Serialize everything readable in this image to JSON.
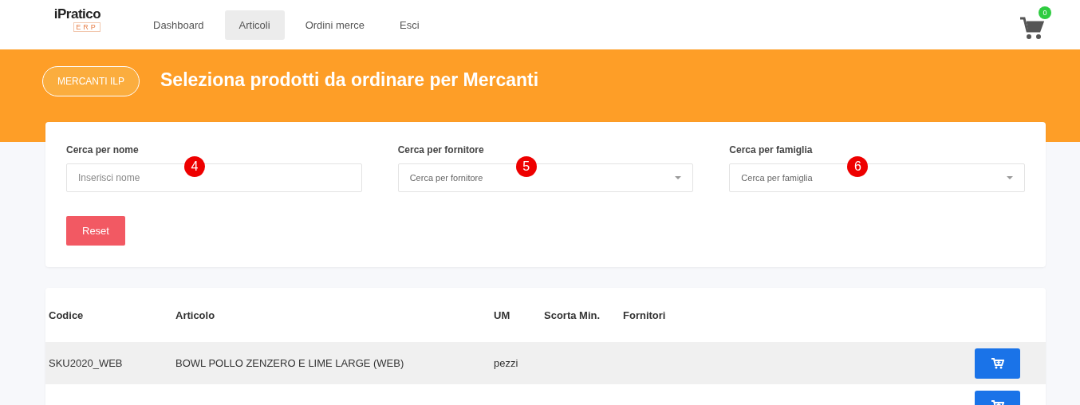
{
  "header": {
    "logo": {
      "name": "iPratico",
      "sub": "ERP"
    },
    "nav": [
      {
        "label": "Dashboard",
        "selected": false
      },
      {
        "label": "Articoli",
        "selected": true
      },
      {
        "label": "Ordini merce",
        "selected": false
      },
      {
        "label": "Esci",
        "selected": false
      }
    ],
    "cart_count": "0"
  },
  "banner": {
    "badge": "MERCANTI ILP",
    "title": "Seleziona prodotti da ordinare per Mercanti"
  },
  "filters": [
    {
      "kind": "text",
      "label": "Cerca per nome",
      "placeholder": "Inserisci nome",
      "marker": "4"
    },
    {
      "kind": "select",
      "label": "Cerca per fornitore",
      "placeholder": "Cerca per fornitore",
      "marker": "5"
    },
    {
      "kind": "select",
      "label": "Cerca per famiglia",
      "placeholder": "Cerca per famiglia",
      "marker": "6"
    }
  ],
  "reset_button": "Reset",
  "table": {
    "columns": [
      "Codice",
      "Articolo",
      "UM",
      "Scorta Min.",
      "Fornitori"
    ],
    "rows": [
      {
        "codice": "SKU2020_WEB",
        "articolo": "BOWL POLLO ZENZERO E LIME LARGE (WEB)",
        "um": "pezzi"
      },
      {}
    ]
  }
}
